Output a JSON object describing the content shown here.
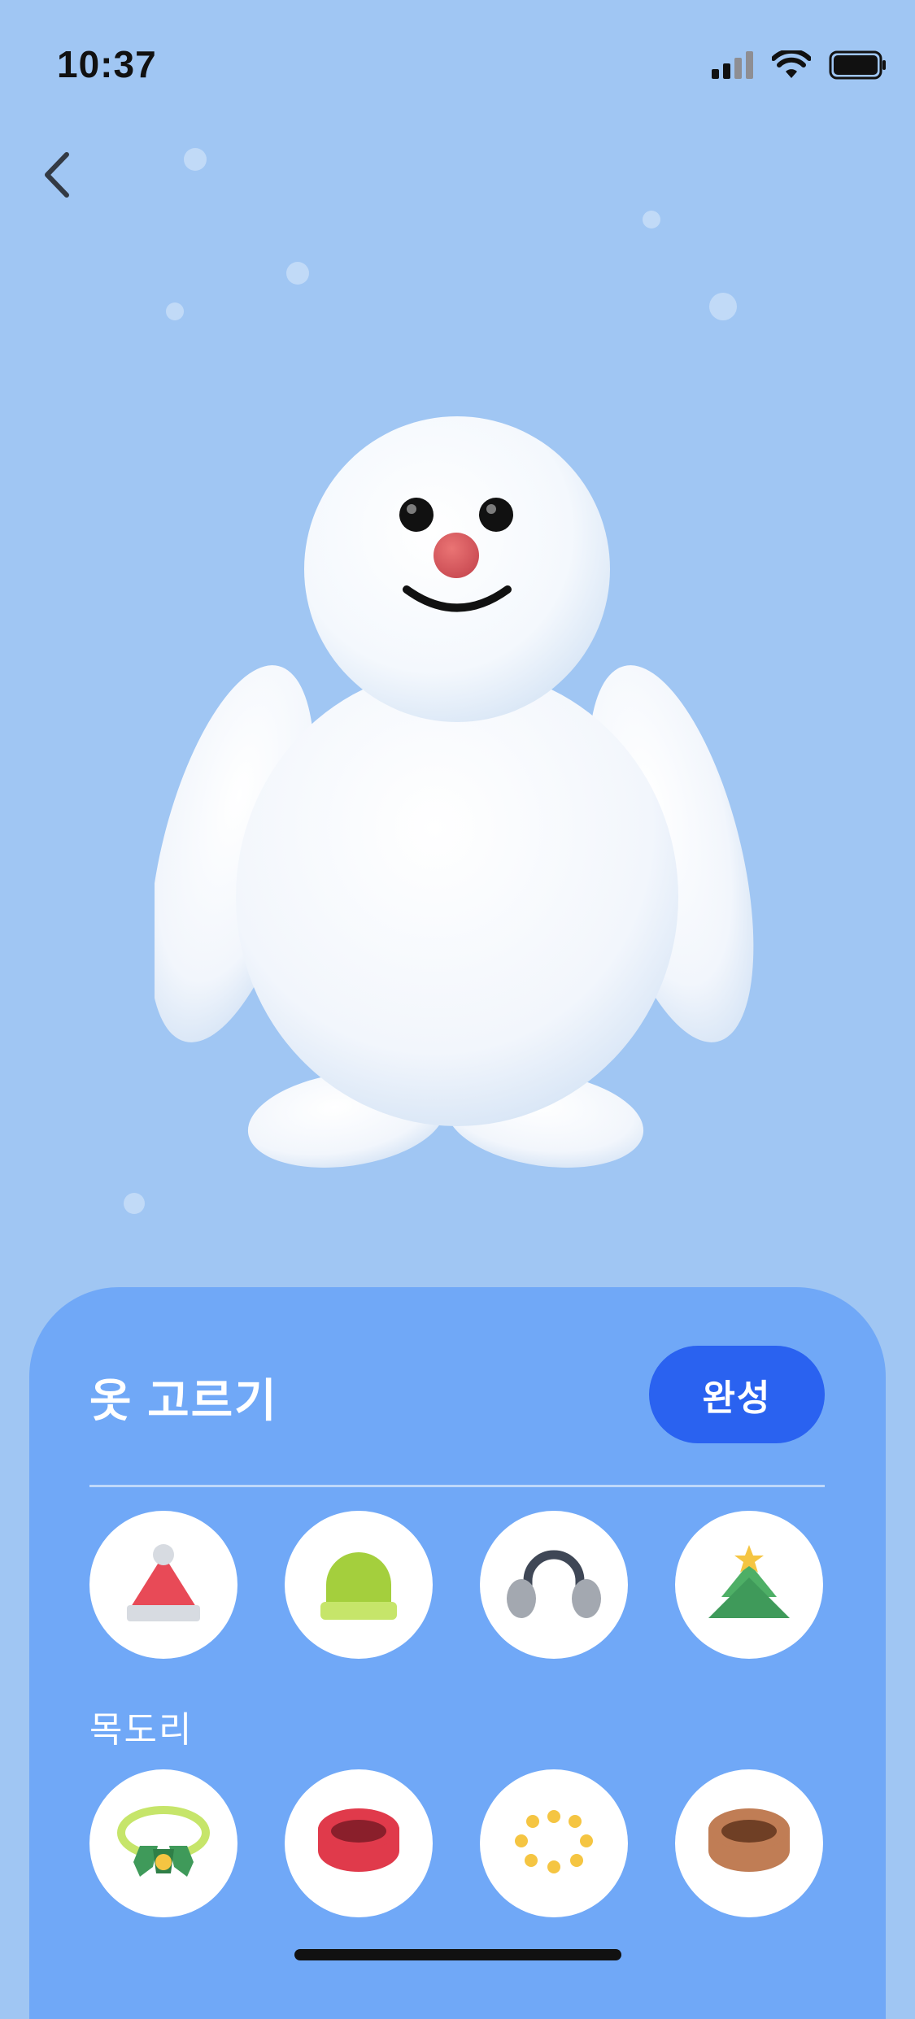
{
  "status_bar": {
    "time": "10:37"
  },
  "panel": {
    "title": "옷 고르기",
    "done_label": "완성",
    "hats": [
      {
        "icon": "santa-hat-icon"
      },
      {
        "icon": "beanie-icon"
      },
      {
        "icon": "earmuffs-icon"
      },
      {
        "icon": "christmas-tree-hat-icon"
      }
    ],
    "scarf_section": {
      "label": "목도리",
      "items": [
        {
          "icon": "holly-wreath-scarf-icon"
        },
        {
          "icon": "red-scarf-icon"
        },
        {
          "icon": "yellow-dots-scarf-icon"
        },
        {
          "icon": "brown-scarf-icon"
        }
      ]
    }
  },
  "colors": {
    "background": "#a0c6f3",
    "panel": "#70a8f7",
    "accent_button": "#2a62f0"
  }
}
